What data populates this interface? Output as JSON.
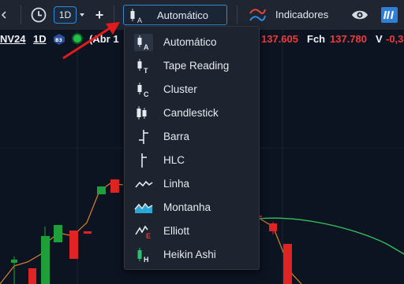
{
  "toolbar": {
    "timeframe": "1D",
    "add": "+",
    "chart_type_selected": "Automático",
    "indicators_label": "Indicadores"
  },
  "info": {
    "symbol": "NV24",
    "timeframe": "1D",
    "open_partial": "(Abr 1",
    "value_prefix": "137.605",
    "close_label": "Fch",
    "close_value": "137.780",
    "var_label": "V",
    "var_value": "-0,3"
  },
  "chart_type_menu": {
    "items": [
      {
        "label": "Automático",
        "icon": "candle-auto-icon"
      },
      {
        "label": "Tape Reading",
        "icon": "candle-tape-icon"
      },
      {
        "label": "Cluster",
        "icon": "candle-cluster-icon"
      },
      {
        "label": "Candlestick",
        "icon": "candlestick-icon"
      },
      {
        "label": "Barra",
        "icon": "bar-icon"
      },
      {
        "label": "HLC",
        "icon": "hlc-icon"
      },
      {
        "label": "Linha",
        "icon": "line-icon"
      },
      {
        "label": "Montanha",
        "icon": "mountain-icon"
      },
      {
        "label": "Elliott",
        "icon": "elliott-icon"
      },
      {
        "label": "Heikin Ashi",
        "icon": "heikin-ashi-icon"
      }
    ]
  },
  "colors": {
    "up": "#1e9f3c",
    "down": "#e02424",
    "accent": "#2f8bd8",
    "ma_green": "#35c25a",
    "ma_orange": "#d9822b",
    "annotation_arrow": "#e11b1b"
  }
}
